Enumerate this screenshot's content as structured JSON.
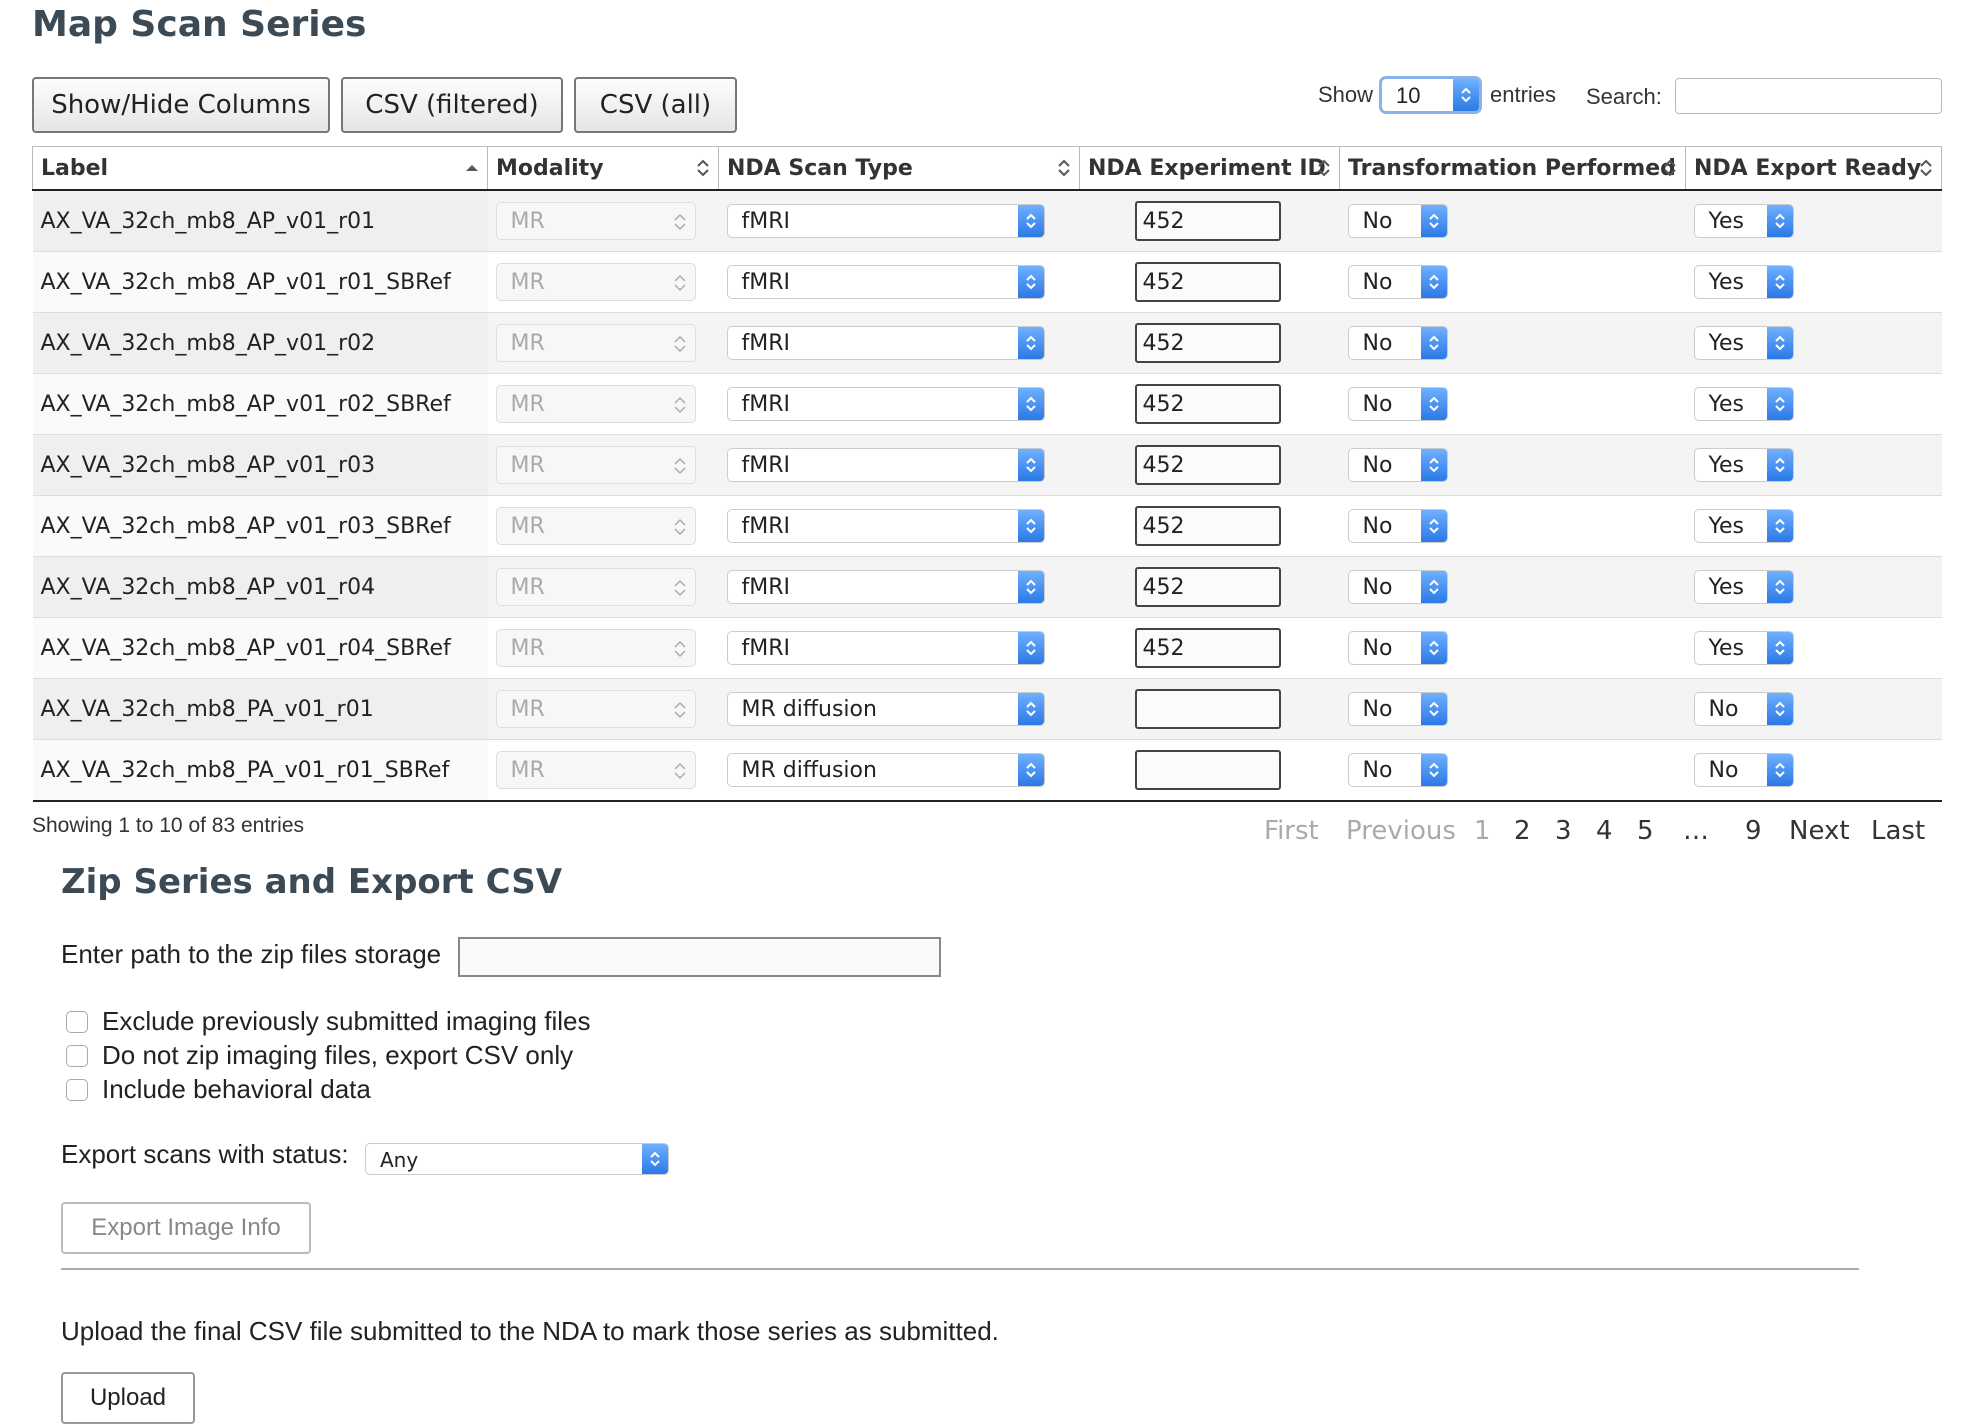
{
  "title": "Map Scan Series",
  "toolbar": {
    "show_hide": "Show/Hide Columns",
    "csv_filtered": "CSV (filtered)",
    "csv_all": "CSV (all)"
  },
  "show": {
    "label": "Show",
    "value": "10",
    "suffix": "entries"
  },
  "search": {
    "label": "Search:",
    "value": ""
  },
  "columns": [
    "Label",
    "Modality",
    "NDA Scan Type",
    "NDA Experiment ID",
    "Transformation Performed",
    "NDA Export Ready"
  ],
  "rows": [
    {
      "label": "AX_VA_32ch_mb8_AP_v01_r01",
      "modality": "MR",
      "scan_type": "fMRI",
      "exp_id": "452",
      "transform": "No",
      "export_ready": "Yes"
    },
    {
      "label": "AX_VA_32ch_mb8_AP_v01_r01_SBRef",
      "modality": "MR",
      "scan_type": "fMRI",
      "exp_id": "452",
      "transform": "No",
      "export_ready": "Yes"
    },
    {
      "label": "AX_VA_32ch_mb8_AP_v01_r02",
      "modality": "MR",
      "scan_type": "fMRI",
      "exp_id": "452",
      "transform": "No",
      "export_ready": "Yes"
    },
    {
      "label": "AX_VA_32ch_mb8_AP_v01_r02_SBRef",
      "modality": "MR",
      "scan_type": "fMRI",
      "exp_id": "452",
      "transform": "No",
      "export_ready": "Yes"
    },
    {
      "label": "AX_VA_32ch_mb8_AP_v01_r03",
      "modality": "MR",
      "scan_type": "fMRI",
      "exp_id": "452",
      "transform": "No",
      "export_ready": "Yes"
    },
    {
      "label": "AX_VA_32ch_mb8_AP_v01_r03_SBRef",
      "modality": "MR",
      "scan_type": "fMRI",
      "exp_id": "452",
      "transform": "No",
      "export_ready": "Yes"
    },
    {
      "label": "AX_VA_32ch_mb8_AP_v01_r04",
      "modality": "MR",
      "scan_type": "fMRI",
      "exp_id": "452",
      "transform": "No",
      "export_ready": "Yes"
    },
    {
      "label": "AX_VA_32ch_mb8_AP_v01_r04_SBRef",
      "modality": "MR",
      "scan_type": "fMRI",
      "exp_id": "452",
      "transform": "No",
      "export_ready": "Yes"
    },
    {
      "label": "AX_VA_32ch_mb8_PA_v01_r01",
      "modality": "MR",
      "scan_type": "MR diffusion",
      "exp_id": "",
      "transform": "No",
      "export_ready": "No"
    },
    {
      "label": "AX_VA_32ch_mb8_PA_v01_r01_SBRef",
      "modality": "MR",
      "scan_type": "MR diffusion",
      "exp_id": "",
      "transform": "No",
      "export_ready": "No"
    }
  ],
  "info": "Showing 1 to 10 of 83 entries",
  "pagination": {
    "first": "First",
    "previous": "Previous",
    "pages": [
      "1",
      "2",
      "3",
      "4",
      "5"
    ],
    "ellipsis": "…",
    "last_page": "9",
    "next": "Next",
    "last": "Last"
  },
  "zip": {
    "title": "Zip Series and Export CSV",
    "path_label": "Enter path to the zip files storage",
    "path_value": "",
    "opt_exclude": "Exclude previously submitted imaging files",
    "opt_nozip": "Do not zip imaging files, export CSV only",
    "opt_behavioral": "Include behavioral data",
    "status_label": "Export scans with status:",
    "status_value": "Any",
    "export_button": "Export Image Info",
    "upload_text": "Upload the final CSV file submitted to the NDA to mark those series as submitted.",
    "upload_button": "Upload"
  },
  "colors": {
    "accent": "#2a79e6",
    "heading": "#3c4a55"
  }
}
